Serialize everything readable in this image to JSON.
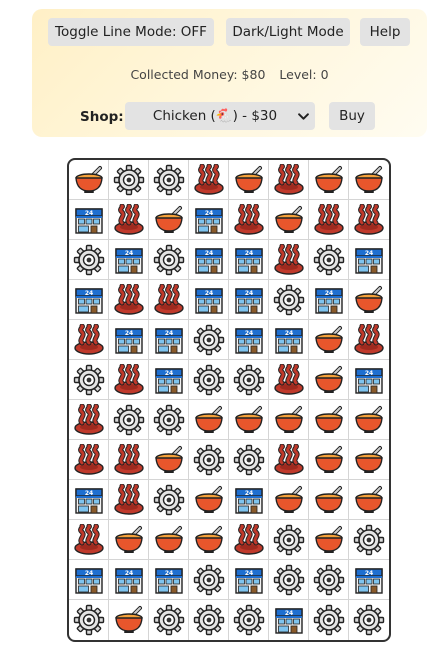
{
  "controls": {
    "toggle_line_label": "Toggle Line Mode: OFF",
    "theme_label": "Dark/Light Mode",
    "help_label": "Help"
  },
  "stats": {
    "money_text": "Collected Money: $80",
    "level_text": "Level: 0"
  },
  "shop": {
    "label": "Shop:",
    "selected": "Chicken (🐔) - $30",
    "buy_label": "Buy"
  },
  "board": {
    "columns": 8,
    "rows_count": 12,
    "rows": [
      [
        "bowl-icon",
        "gear-icon",
        "gear-icon",
        "hotspring-icon",
        "bowl-icon",
        "hotspring-icon",
        "bowl-icon",
        "bowl-icon"
      ],
      [
        "store-icon",
        "hotspring-icon",
        "bowl-icon",
        "store-icon",
        "hotspring-icon",
        "bowl-icon",
        "hotspring-icon",
        "hotspring-icon"
      ],
      [
        "gear-icon",
        "store-icon",
        "gear-icon",
        "store-icon",
        "store-icon",
        "hotspring-icon",
        "gear-icon",
        "store-icon"
      ],
      [
        "store-icon",
        "hotspring-icon",
        "hotspring-icon",
        "store-icon",
        "store-icon",
        "gear-icon",
        "store-icon",
        "bowl-icon"
      ],
      [
        "hotspring-icon",
        "store-icon",
        "store-icon",
        "gear-icon",
        "store-icon",
        "store-icon",
        "bowl-icon",
        "hotspring-icon"
      ],
      [
        "gear-icon",
        "hotspring-icon",
        "store-icon",
        "gear-icon",
        "gear-icon",
        "hotspring-icon",
        "bowl-icon",
        "store-icon"
      ],
      [
        "hotspring-icon",
        "gear-icon",
        "gear-icon",
        "bowl-icon",
        "bowl-icon",
        "bowl-icon",
        "bowl-icon",
        "bowl-icon"
      ],
      [
        "hotspring-icon",
        "hotspring-icon",
        "bowl-icon",
        "gear-icon",
        "gear-icon",
        "hotspring-icon",
        "bowl-icon",
        "bowl-icon"
      ],
      [
        "store-icon",
        "hotspring-icon",
        "gear-icon",
        "bowl-icon",
        "store-icon",
        "bowl-icon",
        "bowl-icon",
        "bowl-icon"
      ],
      [
        "hotspring-icon",
        "bowl-icon",
        "bowl-icon",
        "bowl-icon",
        "hotspring-icon",
        "gear-icon",
        "bowl-icon",
        "gear-icon"
      ],
      [
        "store-icon",
        "store-icon",
        "store-icon",
        "gear-icon",
        "store-icon",
        "gear-icon",
        "gear-icon",
        "store-icon"
      ],
      [
        "gear-icon",
        "bowl-icon",
        "gear-icon",
        "gear-icon",
        "gear-icon",
        "store-icon",
        "gear-icon",
        "gear-icon"
      ]
    ]
  }
}
